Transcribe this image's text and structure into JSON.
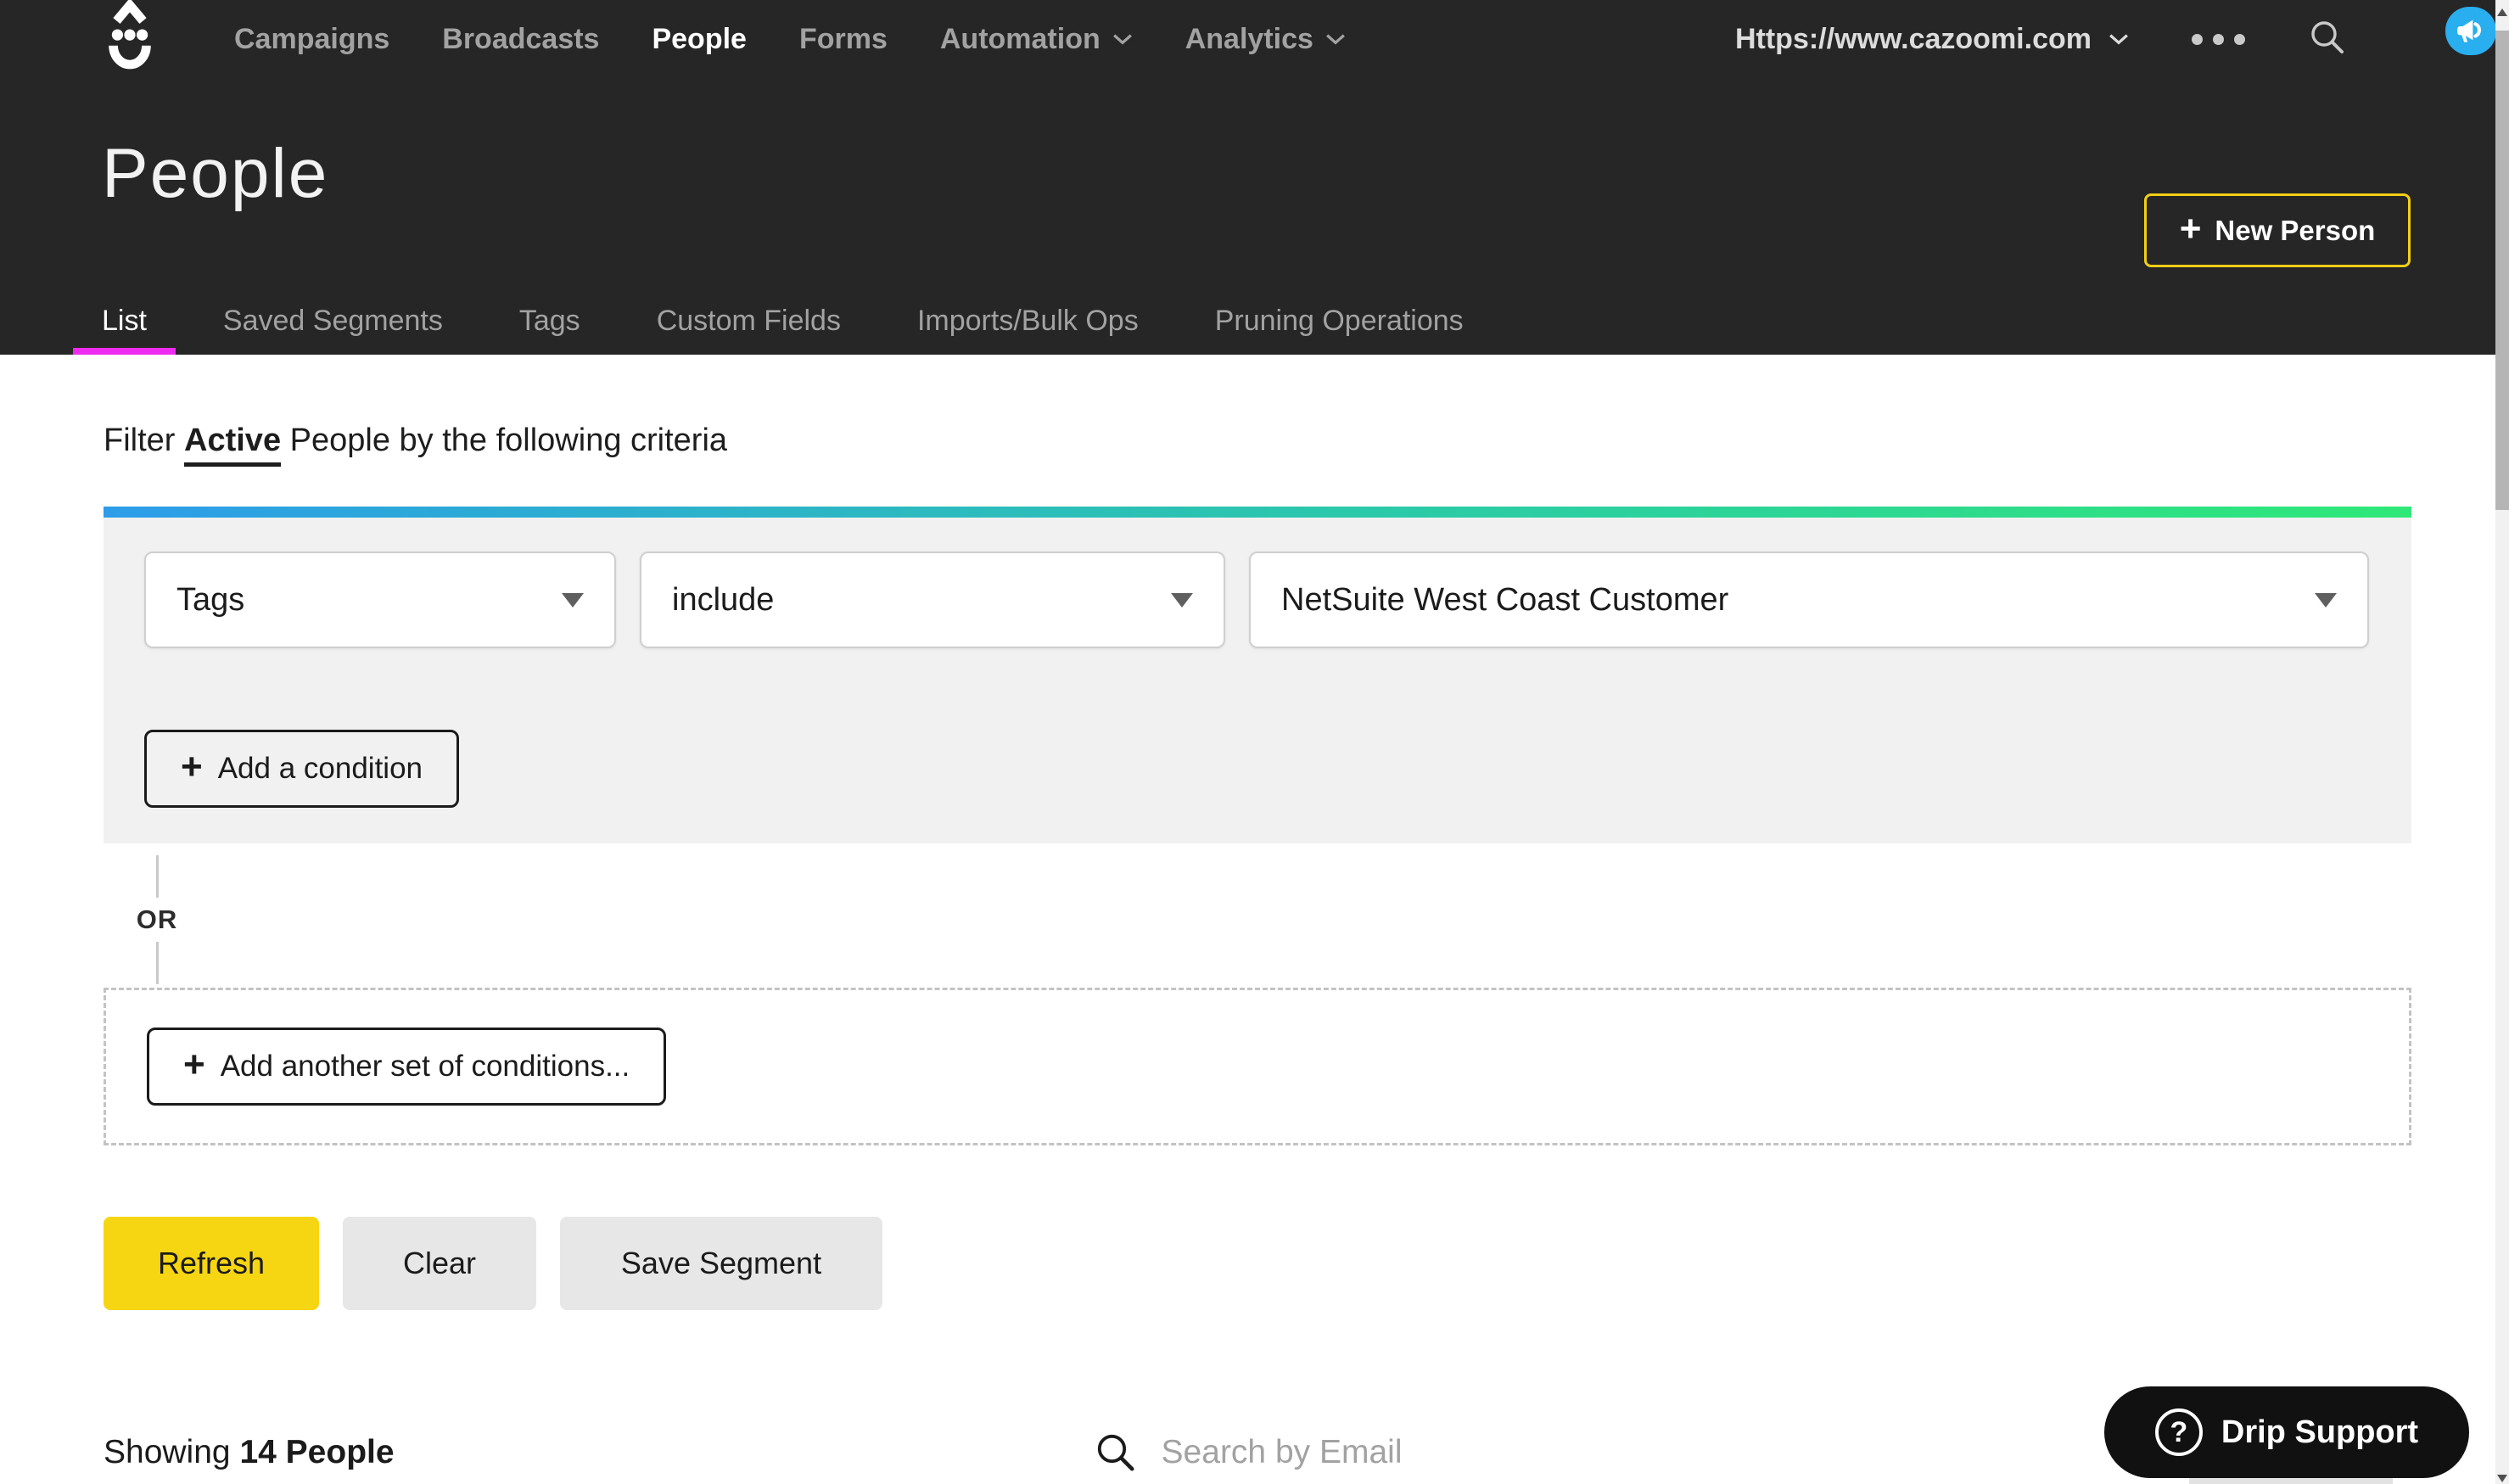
{
  "header": {
    "nav": [
      {
        "label": "Campaigns",
        "active": false
      },
      {
        "label": "Broadcasts",
        "active": false
      },
      {
        "label": "People",
        "active": true
      },
      {
        "label": "Forms",
        "active": false
      },
      {
        "label": "Automation",
        "active": false
      },
      {
        "label": "Analytics",
        "active": false
      }
    ],
    "account_url": "Https://www.cazoomi.com",
    "title": "People",
    "new_person_label": "New Person",
    "tabs": [
      {
        "label": "List",
        "active": true
      },
      {
        "label": "Saved Segments",
        "active": false
      },
      {
        "label": "Tags",
        "active": false
      },
      {
        "label": "Custom Fields",
        "active": false
      },
      {
        "label": "Imports/Bulk Ops",
        "active": false
      },
      {
        "label": "Pruning Operations",
        "active": false
      }
    ]
  },
  "filter": {
    "sentence_prefix": "Filter",
    "status_value": "Active",
    "sentence_suffix": "People by the following criteria",
    "condition": {
      "field": "Tags",
      "operator": "include",
      "value": "NetSuite West Coast Customer"
    },
    "add_condition_label": "Add a condition",
    "or_label": "OR",
    "add_set_label": "Add another set of conditions...",
    "refresh_label": "Refresh",
    "clear_label": "Clear",
    "save_segment_label": "Save Segment"
  },
  "results": {
    "showing_prefix": "Showing",
    "count_label": "14 People",
    "search_placeholder": "Search by Email"
  },
  "support": {
    "label": "Drip Support"
  },
  "icons": {
    "plus": "+",
    "question": "?"
  },
  "colors": {
    "header_bg": "#262626",
    "active_tab_underline": "#ee2bf0",
    "accent_yellow": "#f6d513",
    "new_person_border": "#f2cf16",
    "gradient_start": "#2d9de9",
    "gradient_mid": "#2bc9a9",
    "gradient_end": "#2fe878",
    "notification_badge": "#29aeef",
    "support_pill": "#111111"
  }
}
